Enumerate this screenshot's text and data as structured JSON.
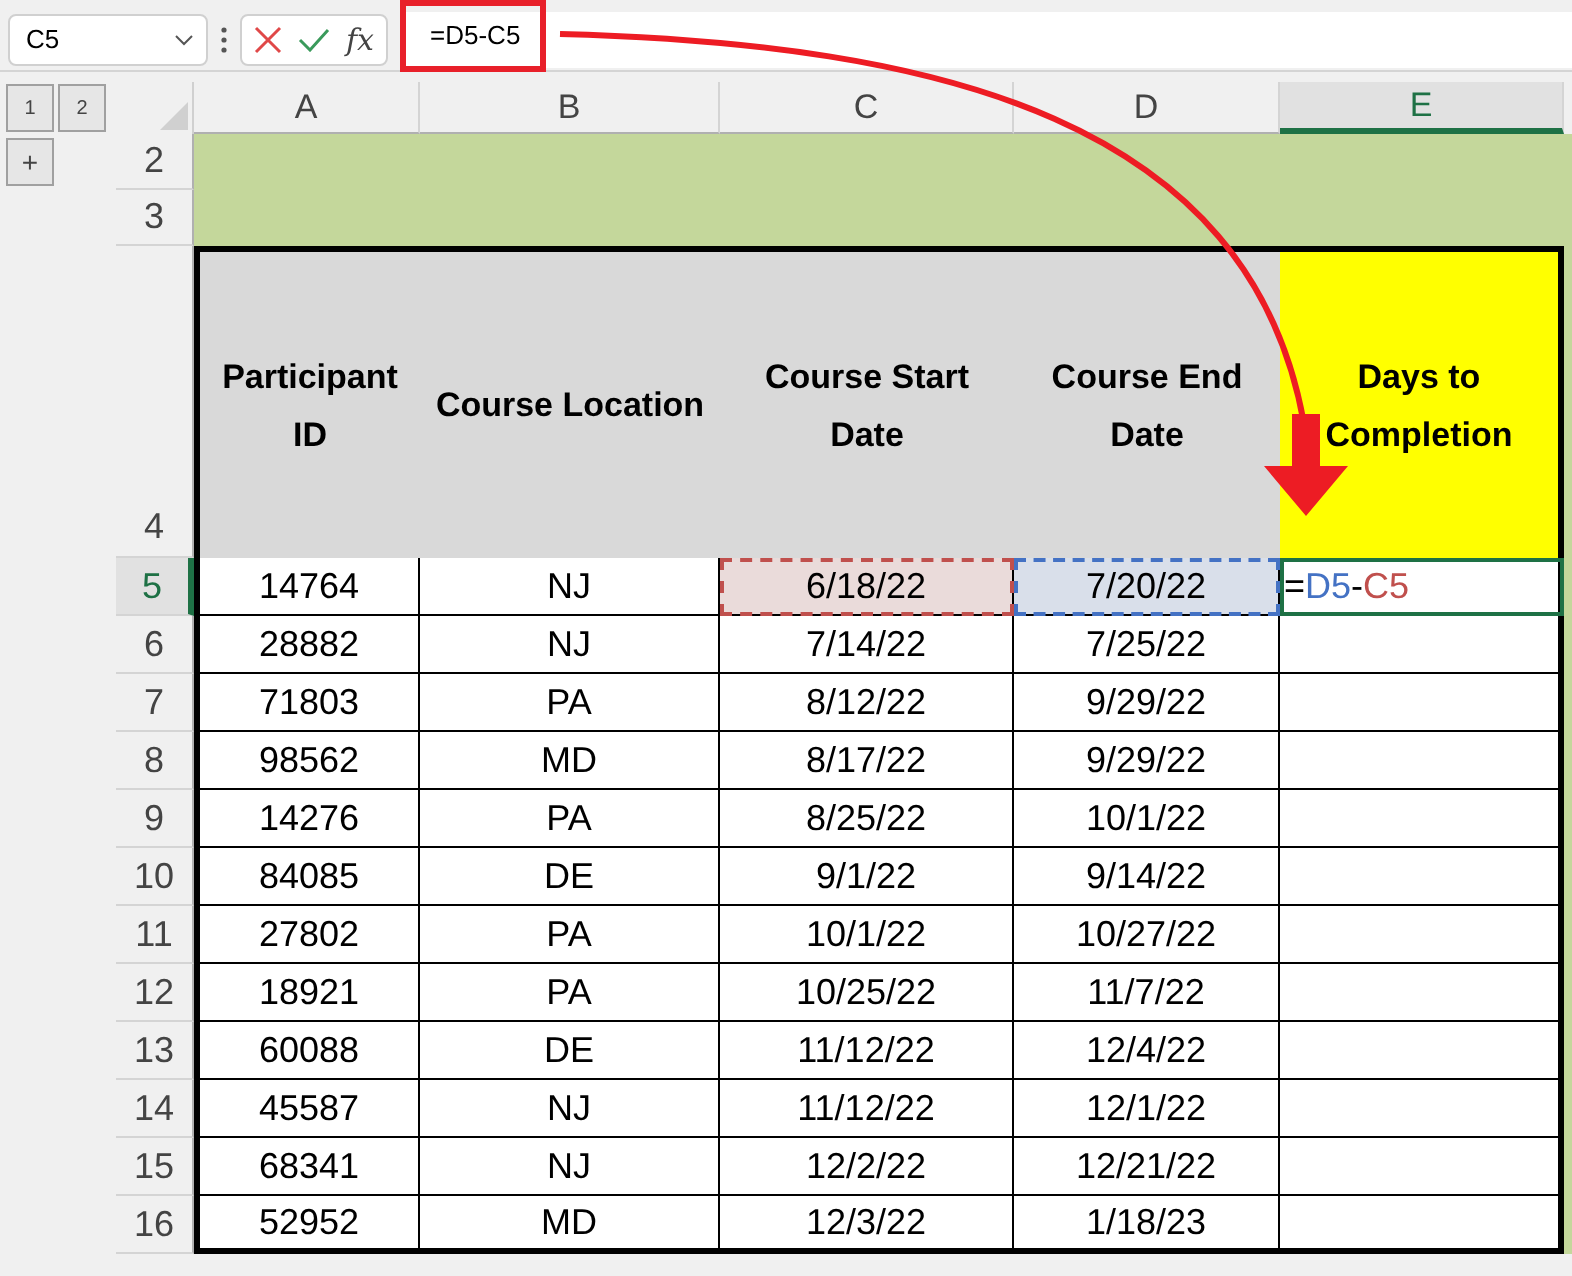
{
  "formula_bar": {
    "name_box": "C5",
    "fx": "fx",
    "formula": "=D5-C5",
    "highlighted": true
  },
  "outline": {
    "levels": [
      "1",
      "2"
    ],
    "expand": "+"
  },
  "columns": [
    {
      "label": "A",
      "selected": false
    },
    {
      "label": "B",
      "selected": false
    },
    {
      "label": "C",
      "selected": false
    },
    {
      "label": "D",
      "selected": false
    },
    {
      "label": "E",
      "selected": true
    }
  ],
  "band_rows": [
    {
      "number": "2",
      "selected": false
    },
    {
      "number": "3",
      "selected": false
    }
  ],
  "header_row": {
    "number": "4",
    "selected": false,
    "cells": [
      {
        "text": "Participant ID",
        "highlight": false
      },
      {
        "text": "Course Location",
        "highlight": false
      },
      {
        "text": "Course Start Date",
        "highlight": false
      },
      {
        "text": "Course End Date",
        "highlight": false
      },
      {
        "text": "Days to Completion",
        "highlight": true
      }
    ]
  },
  "rows": [
    {
      "number": "5",
      "selected": true,
      "cells": [
        "14764",
        "NJ",
        {
          "text": "6/18/22",
          "color": "#c0504d"
        },
        {
          "text": "7/20/22",
          "color": "#4472c4"
        }
      ],
      "formula": [
        {
          "text": "=",
          "color": "#000000"
        },
        {
          "text": "D5",
          "color": "#4472c4"
        },
        {
          "text": "-",
          "color": "#000000"
        },
        {
          "text": "C5",
          "color": "#c0504d"
        }
      ]
    },
    {
      "number": "6",
      "selected": false,
      "cells": [
        "28882",
        "NJ",
        "7/14/22",
        "7/25/22"
      ]
    },
    {
      "number": "7",
      "selected": false,
      "cells": [
        "71803",
        "PA",
        "8/12/22",
        "9/29/22"
      ]
    },
    {
      "number": "8",
      "selected": false,
      "cells": [
        "98562",
        "MD",
        "8/17/22",
        "9/29/22"
      ]
    },
    {
      "number": "9",
      "selected": false,
      "cells": [
        "14276",
        "PA",
        "8/25/22",
        "10/1/22"
      ]
    },
    {
      "number": "10",
      "selected": false,
      "cells": [
        "84085",
        "DE",
        "9/1/22",
        "9/14/22"
      ]
    },
    {
      "number": "11",
      "selected": false,
      "cells": [
        "27802",
        "PA",
        "10/1/22",
        "10/27/22"
      ]
    },
    {
      "number": "12",
      "selected": false,
      "cells": [
        "18921",
        "PA",
        "10/25/22",
        "11/7/22"
      ]
    },
    {
      "number": "13",
      "selected": false,
      "cells": [
        "60088",
        "DE",
        "11/12/22",
        "12/4/22"
      ]
    },
    {
      "number": "14",
      "selected": false,
      "cells": [
        "45587",
        "NJ",
        "11/12/22",
        "12/1/22"
      ]
    },
    {
      "number": "15",
      "selected": false,
      "cells": [
        "68341",
        "NJ",
        "12/2/22",
        "12/21/22"
      ]
    },
    {
      "number": "16",
      "selected": false,
      "cells": [
        "52952",
        "MD",
        "12/3/22",
        "1/18/23"
      ]
    }
  ]
}
